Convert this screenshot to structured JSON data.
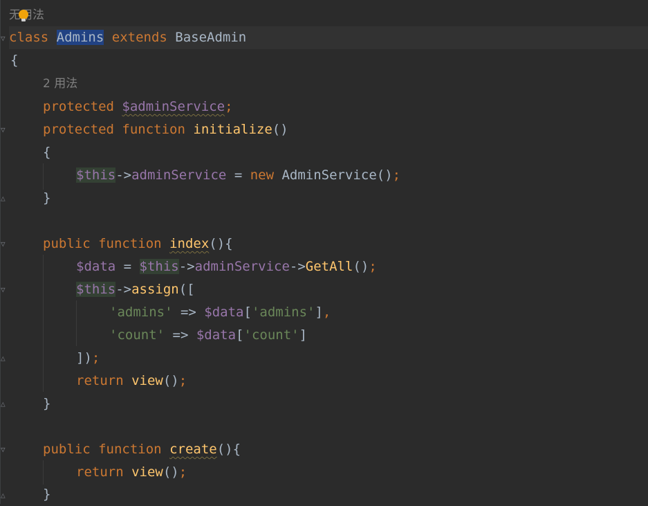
{
  "editor": {
    "usage_hint_top": "无用法",
    "usage_hint_2": "2 用法",
    "lines": {
      "l1_class": "class",
      "l1_name": "Admins",
      "l1_extends": "extends",
      "l1_base": "BaseAdmin",
      "l2_brace": "{",
      "l4_protected": "protected",
      "l4_var": "$adminService",
      "l4_semi": ";",
      "l5_protected": "protected",
      "l5_function": "function",
      "l5_name": "initialize",
      "l5_parens": "()",
      "l6_brace": "{",
      "l7_this": "$this",
      "l7_arrow": "->",
      "l7_prop": "adminService",
      "l7_eq": " = ",
      "l7_new": "new",
      "l7_class": "AdminService",
      "l7_call": "()",
      "l7_semi": ";",
      "l8_brace": "}",
      "l10_public": "public",
      "l10_function": "function",
      "l10_name": "index",
      "l10_rest": "(){",
      "l11_var": "$data",
      "l11_eq": " = ",
      "l11_this": "$this",
      "l11_arrow1": "->",
      "l11_prop": "adminService",
      "l11_arrow2": "->",
      "l11_fn": "GetAll",
      "l11_call": "()",
      "l11_semi": ";",
      "l12_this": "$this",
      "l12_arrow": "->",
      "l12_fn": "assign",
      "l12_open": "([",
      "l13_key": "'admins'",
      "l13_op": " => ",
      "l13_var": "$data",
      "l13_lb": "[",
      "l13_idx": "'admins'",
      "l13_rb": "]",
      "l13_comma": ",",
      "l14_key": "'count'",
      "l14_op": " => ",
      "l14_var": "$data",
      "l14_lb": "[",
      "l14_idx": "'count'",
      "l14_rb": "]",
      "l15_close": "])",
      "l15_semi": ";",
      "l16_return": "return",
      "l16_fn": "view",
      "l16_call": "()",
      "l16_semi": ";",
      "l17_brace": "}",
      "l19_public": "public",
      "l19_function": "function",
      "l19_name": "create",
      "l19_rest": "(){",
      "l20_return": "return",
      "l20_fn": "view",
      "l20_call": "()",
      "l20_semi": ";",
      "l21_brace": "}"
    }
  },
  "colors": {
    "background": "#2b2b2b",
    "keyword": "#cc7832",
    "function": "#ffc66d",
    "variable": "#9876aa",
    "string": "#6a8759",
    "text": "#a9b7c6",
    "selection": "#214283"
  },
  "icons": {
    "bulb": "lightbulb-icon",
    "fold": "fold-marker-icon"
  }
}
